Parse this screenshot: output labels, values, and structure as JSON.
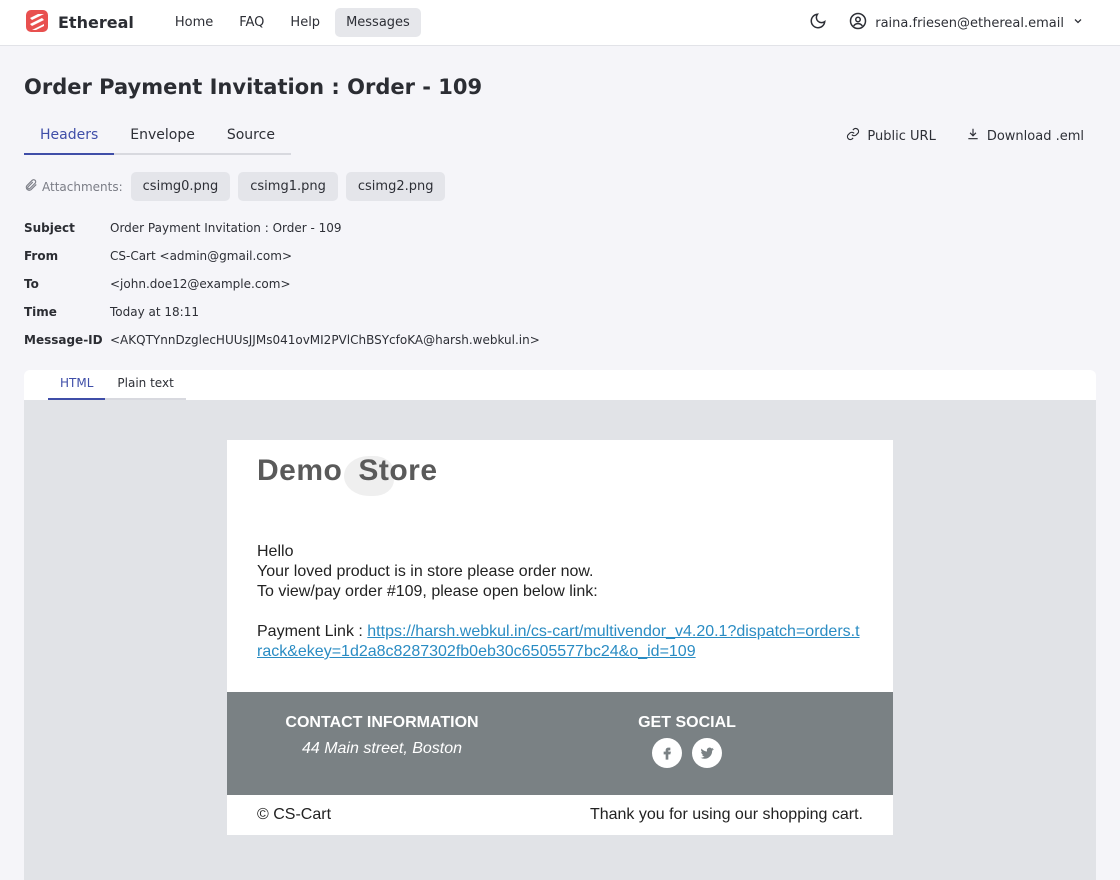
{
  "app": {
    "brand": "Ethereal",
    "nav": [
      "Home",
      "FAQ",
      "Help",
      "Messages"
    ],
    "user_email": "raina.friesen@ethereal.email"
  },
  "message": {
    "title": "Order Payment Invitation : Order - 109",
    "tabs": [
      "Headers",
      "Envelope",
      "Source"
    ],
    "actions": {
      "public_url": "Public URL",
      "download": "Download .eml"
    },
    "attachments_label": "Attachments:",
    "attachments": [
      "csimg0.png",
      "csimg1.png",
      "csimg2.png"
    ],
    "headers": [
      {
        "key": "Subject",
        "value": "Order Payment Invitation : Order - 109"
      },
      {
        "key": "From",
        "value": "CS-Cart <admin@gmail.com>"
      },
      {
        "key": "To",
        "value": "<john.doe12@example.com>"
      },
      {
        "key": "Time",
        "value": "Today at 18:11"
      },
      {
        "key": "Message-ID",
        "value": "<AKQTYnnDzglecHUUsJJMs041ovMI2PVlChBSYcfoKA@harsh.webkul.in>"
      }
    ],
    "view_tabs": [
      "HTML",
      "Plain text"
    ]
  },
  "email": {
    "logo_word1": "Demo",
    "logo_word2": "Store",
    "greeting": "Hello",
    "line1": "Your loved product is in store please order now.",
    "line2": "To view/pay order #109, please open below link:",
    "payment_label": "Payment Link : ",
    "payment_link": "https://harsh.webkul.in/cs-cart/multivendor_v4.20.1?dispatch=orders.track&ekey=1d2a8c8287302fb0eb30c6505577bc24&o_id=109",
    "contact_title": "CONTACT INFORMATION",
    "contact_address": "44 Main street, Boston",
    "social_title": "GET SOCIAL",
    "copyright": "© CS-Cart",
    "thanks": "Thank you for using our shopping cart."
  },
  "colors": {
    "accent": "#3f4ea8",
    "brand": "#e8504f",
    "link": "#2a8cc3",
    "footer": "#7a8184"
  }
}
